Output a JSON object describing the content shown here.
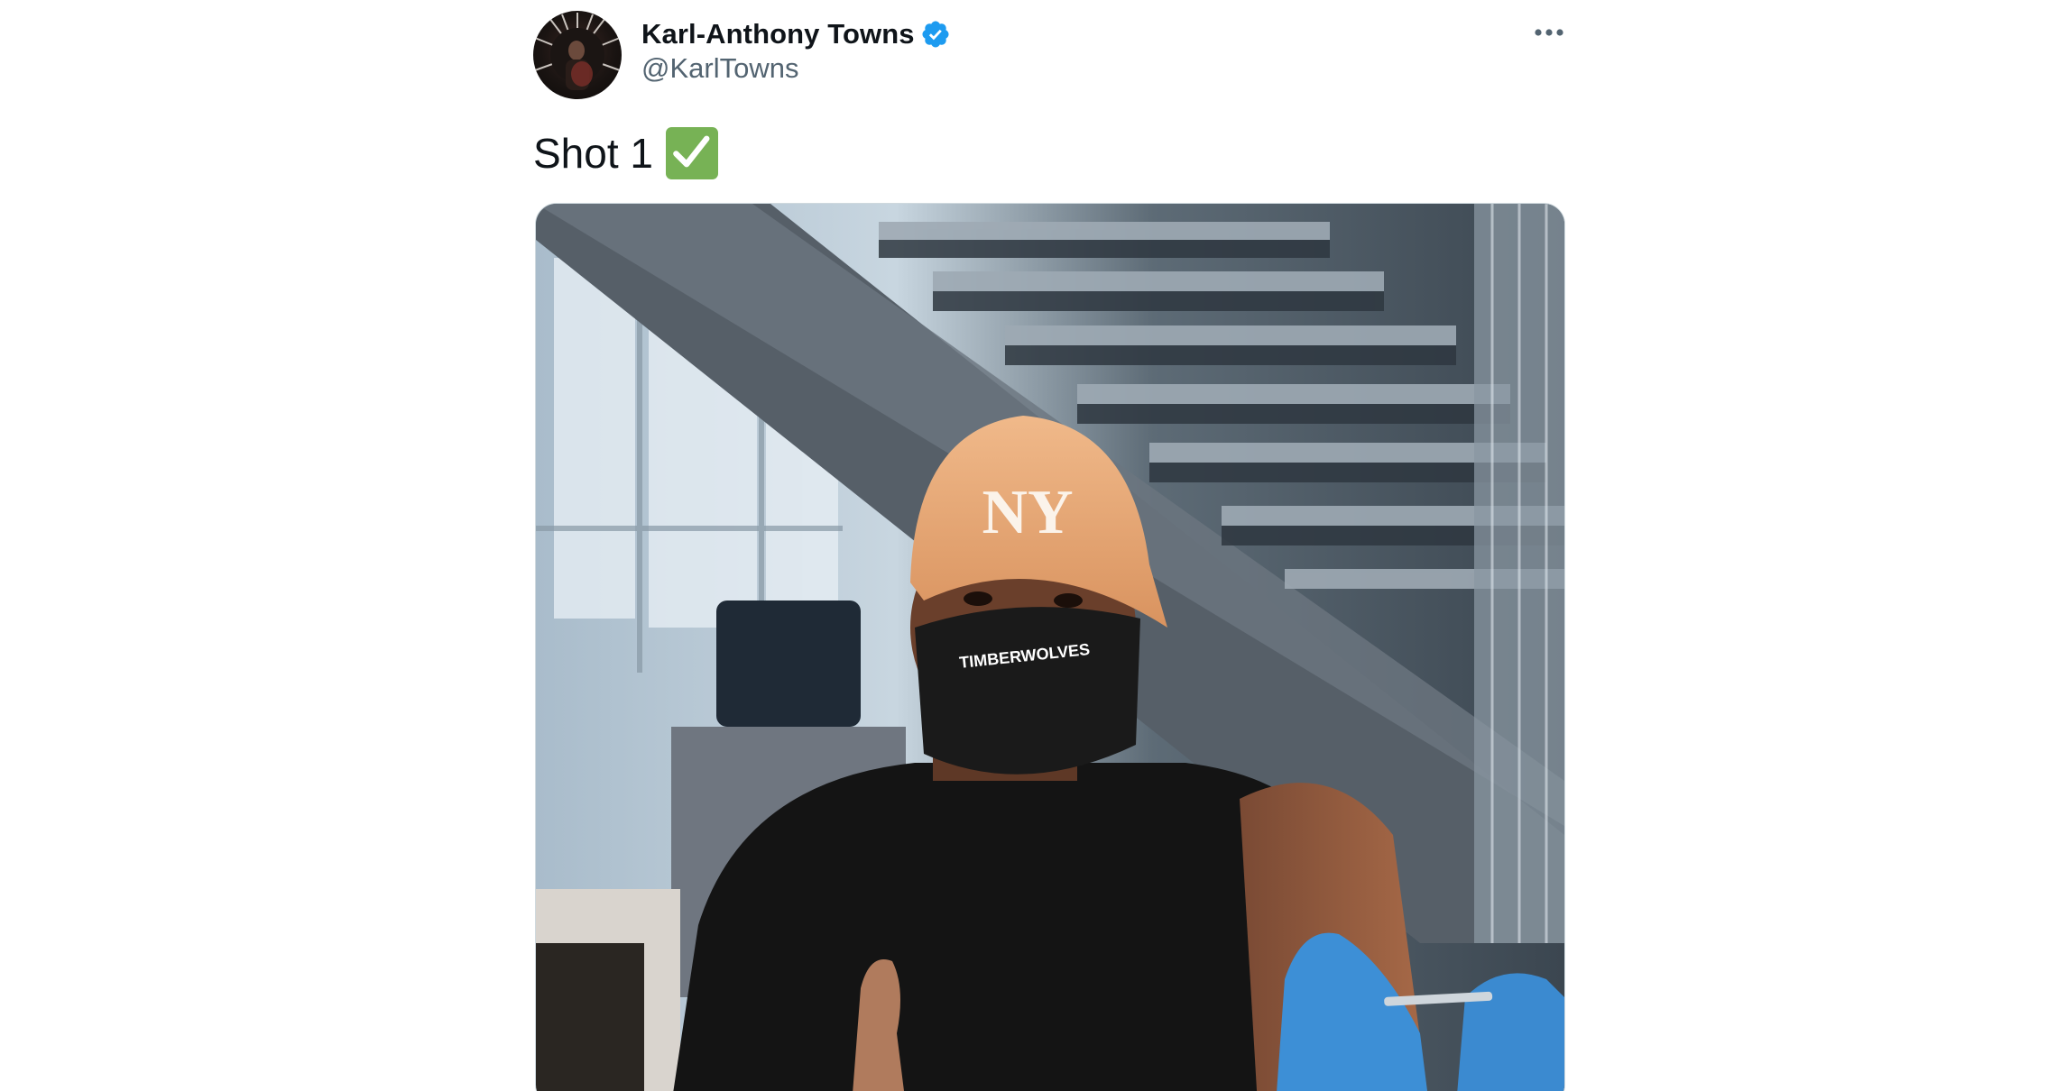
{
  "tweet": {
    "author": {
      "display_name": "Karl-Anthony Towns",
      "handle": "@KarlTowns",
      "verified": true,
      "avatar_icon": "profile-photo"
    },
    "text": "Shot 1",
    "emoji": "white-heavy-check-mark-icon",
    "more_icon": "more-options-icon",
    "media": {
      "type": "photo",
      "cap_text": "NY",
      "mask_text": "TIMBERWOLVES"
    }
  },
  "colors": {
    "verified": "#1d9bf0",
    "check_emoji_bg": "#77b255",
    "name": "#0f1419",
    "handle": "#536471"
  }
}
